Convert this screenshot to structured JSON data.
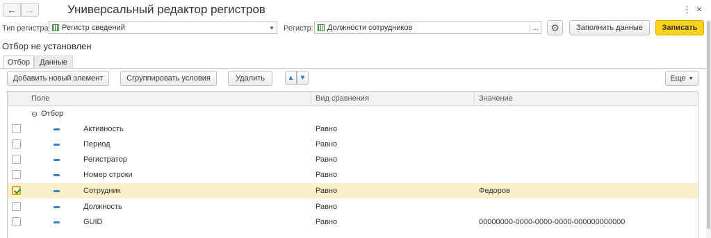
{
  "header": {
    "title": "Универсальный редактор регистров"
  },
  "params": {
    "register_type_label": "Тип регистра:",
    "register_type_value": "Регистр сведений",
    "register_label": "Регистр:",
    "register_value": "Должности сотрудников",
    "register_browse": "...",
    "fill_button": "Заполнить данные",
    "save_button": "Записать"
  },
  "filter_state": "Отбор не установлен",
  "tabs": [
    {
      "label": "Отбор"
    },
    {
      "label": "Данные"
    }
  ],
  "toolbar": {
    "add": "Добавить новый элемент",
    "group": "Сгруппировать условия",
    "delete": "Удалить",
    "more": "Еще"
  },
  "table": {
    "columns": [
      "Поле",
      "Вид сравнения",
      "Значение"
    ],
    "group_label": "Отбор",
    "rows": [
      {
        "field": "Активность",
        "comparison": "Равно",
        "value": "",
        "checked": false
      },
      {
        "field": "Период",
        "comparison": "Равно",
        "value": "",
        "checked": false
      },
      {
        "field": "Регистратор",
        "comparison": "Равно",
        "value": "",
        "checked": false
      },
      {
        "field": "Номер строки",
        "comparison": "Равно",
        "value": "",
        "checked": false
      },
      {
        "field": "Сотрудник",
        "comparison": "Равно",
        "value": "Федоров",
        "checked": true
      },
      {
        "field": "Должность",
        "comparison": "Равно",
        "value": "",
        "checked": false
      },
      {
        "field": "GUID",
        "comparison": "Равно",
        "value": "00000000-0000-0000-0000-000000000000",
        "checked": false
      }
    ]
  },
  "colors": {
    "accent": "#ffd21c",
    "selected_row": "#fbf0c8",
    "icon_blue": "#2b7bd2"
  }
}
